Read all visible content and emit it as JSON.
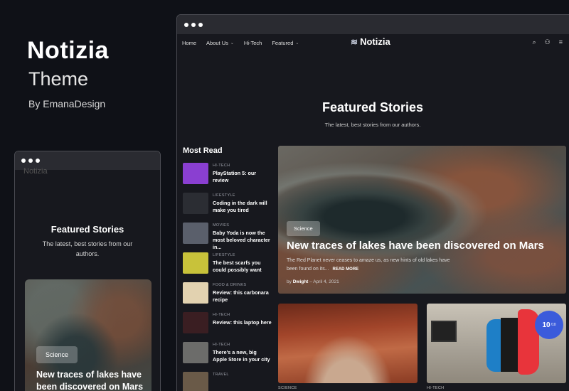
{
  "promo": {
    "title": "Notizia",
    "subtitle": "Theme",
    "byline": "By EmanaDesign"
  },
  "mobile": {
    "logo_peek": "Notizia",
    "featured_title": "Featured Stories",
    "featured_sub": "The latest, best stories from our authors.",
    "card": {
      "badge": "Science",
      "headline": "New traces of lakes have been discovered on Mars"
    }
  },
  "desktop": {
    "nav": {
      "items": [
        "Home",
        "About Us",
        "Hi-Tech",
        "Featured"
      ],
      "logo": "Notizia",
      "icons": [
        "search-icon",
        "user-icon",
        "menu-icon"
      ]
    },
    "featured_title": "Featured Stories",
    "featured_sub": "The latest, best stories from our authors.",
    "most_read": {
      "heading": "Most Read",
      "items": [
        {
          "category": "HI-TECH",
          "title": "PlayStation 5: our review",
          "color": "#8a3fd1"
        },
        {
          "category": "LIFESTYLE",
          "title": "Coding in the dark will make you tired",
          "color": "#2b2d33"
        },
        {
          "category": "MOVIES",
          "title": "Baby Yoda is now the most beloved character in...",
          "color": "#5a5f6b"
        },
        {
          "category": "LIFESTYLE",
          "title": "The best scarfs you could possibly want",
          "color": "#c8c23a"
        },
        {
          "category": "FOOD & DRINKS",
          "title": "Review: this carbonara recipe",
          "color": "#e2d2b0"
        },
        {
          "category": "HI-TECH",
          "title": "Review: this laptop here",
          "color": "#3a1e22"
        },
        {
          "category": "HI-TECH",
          "title": "There's a new, big Apple Store in your city",
          "color": "#6c6c6a"
        },
        {
          "category": "TRAVEL",
          "title": "",
          "color": "#6a5a48"
        }
      ]
    },
    "hero": {
      "badge": "Science",
      "headline": "New traces of lakes have been discovered on Mars",
      "excerpt": "The Red Planet never ceases to amaze us, as new hints of old lakes have been found on its...",
      "read_more": "READ MORE",
      "author_prefix": "by",
      "author": "Dwight",
      "date": "April 4, 2021"
    },
    "cards": [
      {
        "category": "SCIENCE"
      },
      {
        "category": "HI-TECH",
        "score": "10",
        "score_suffix": "/10"
      }
    ]
  }
}
